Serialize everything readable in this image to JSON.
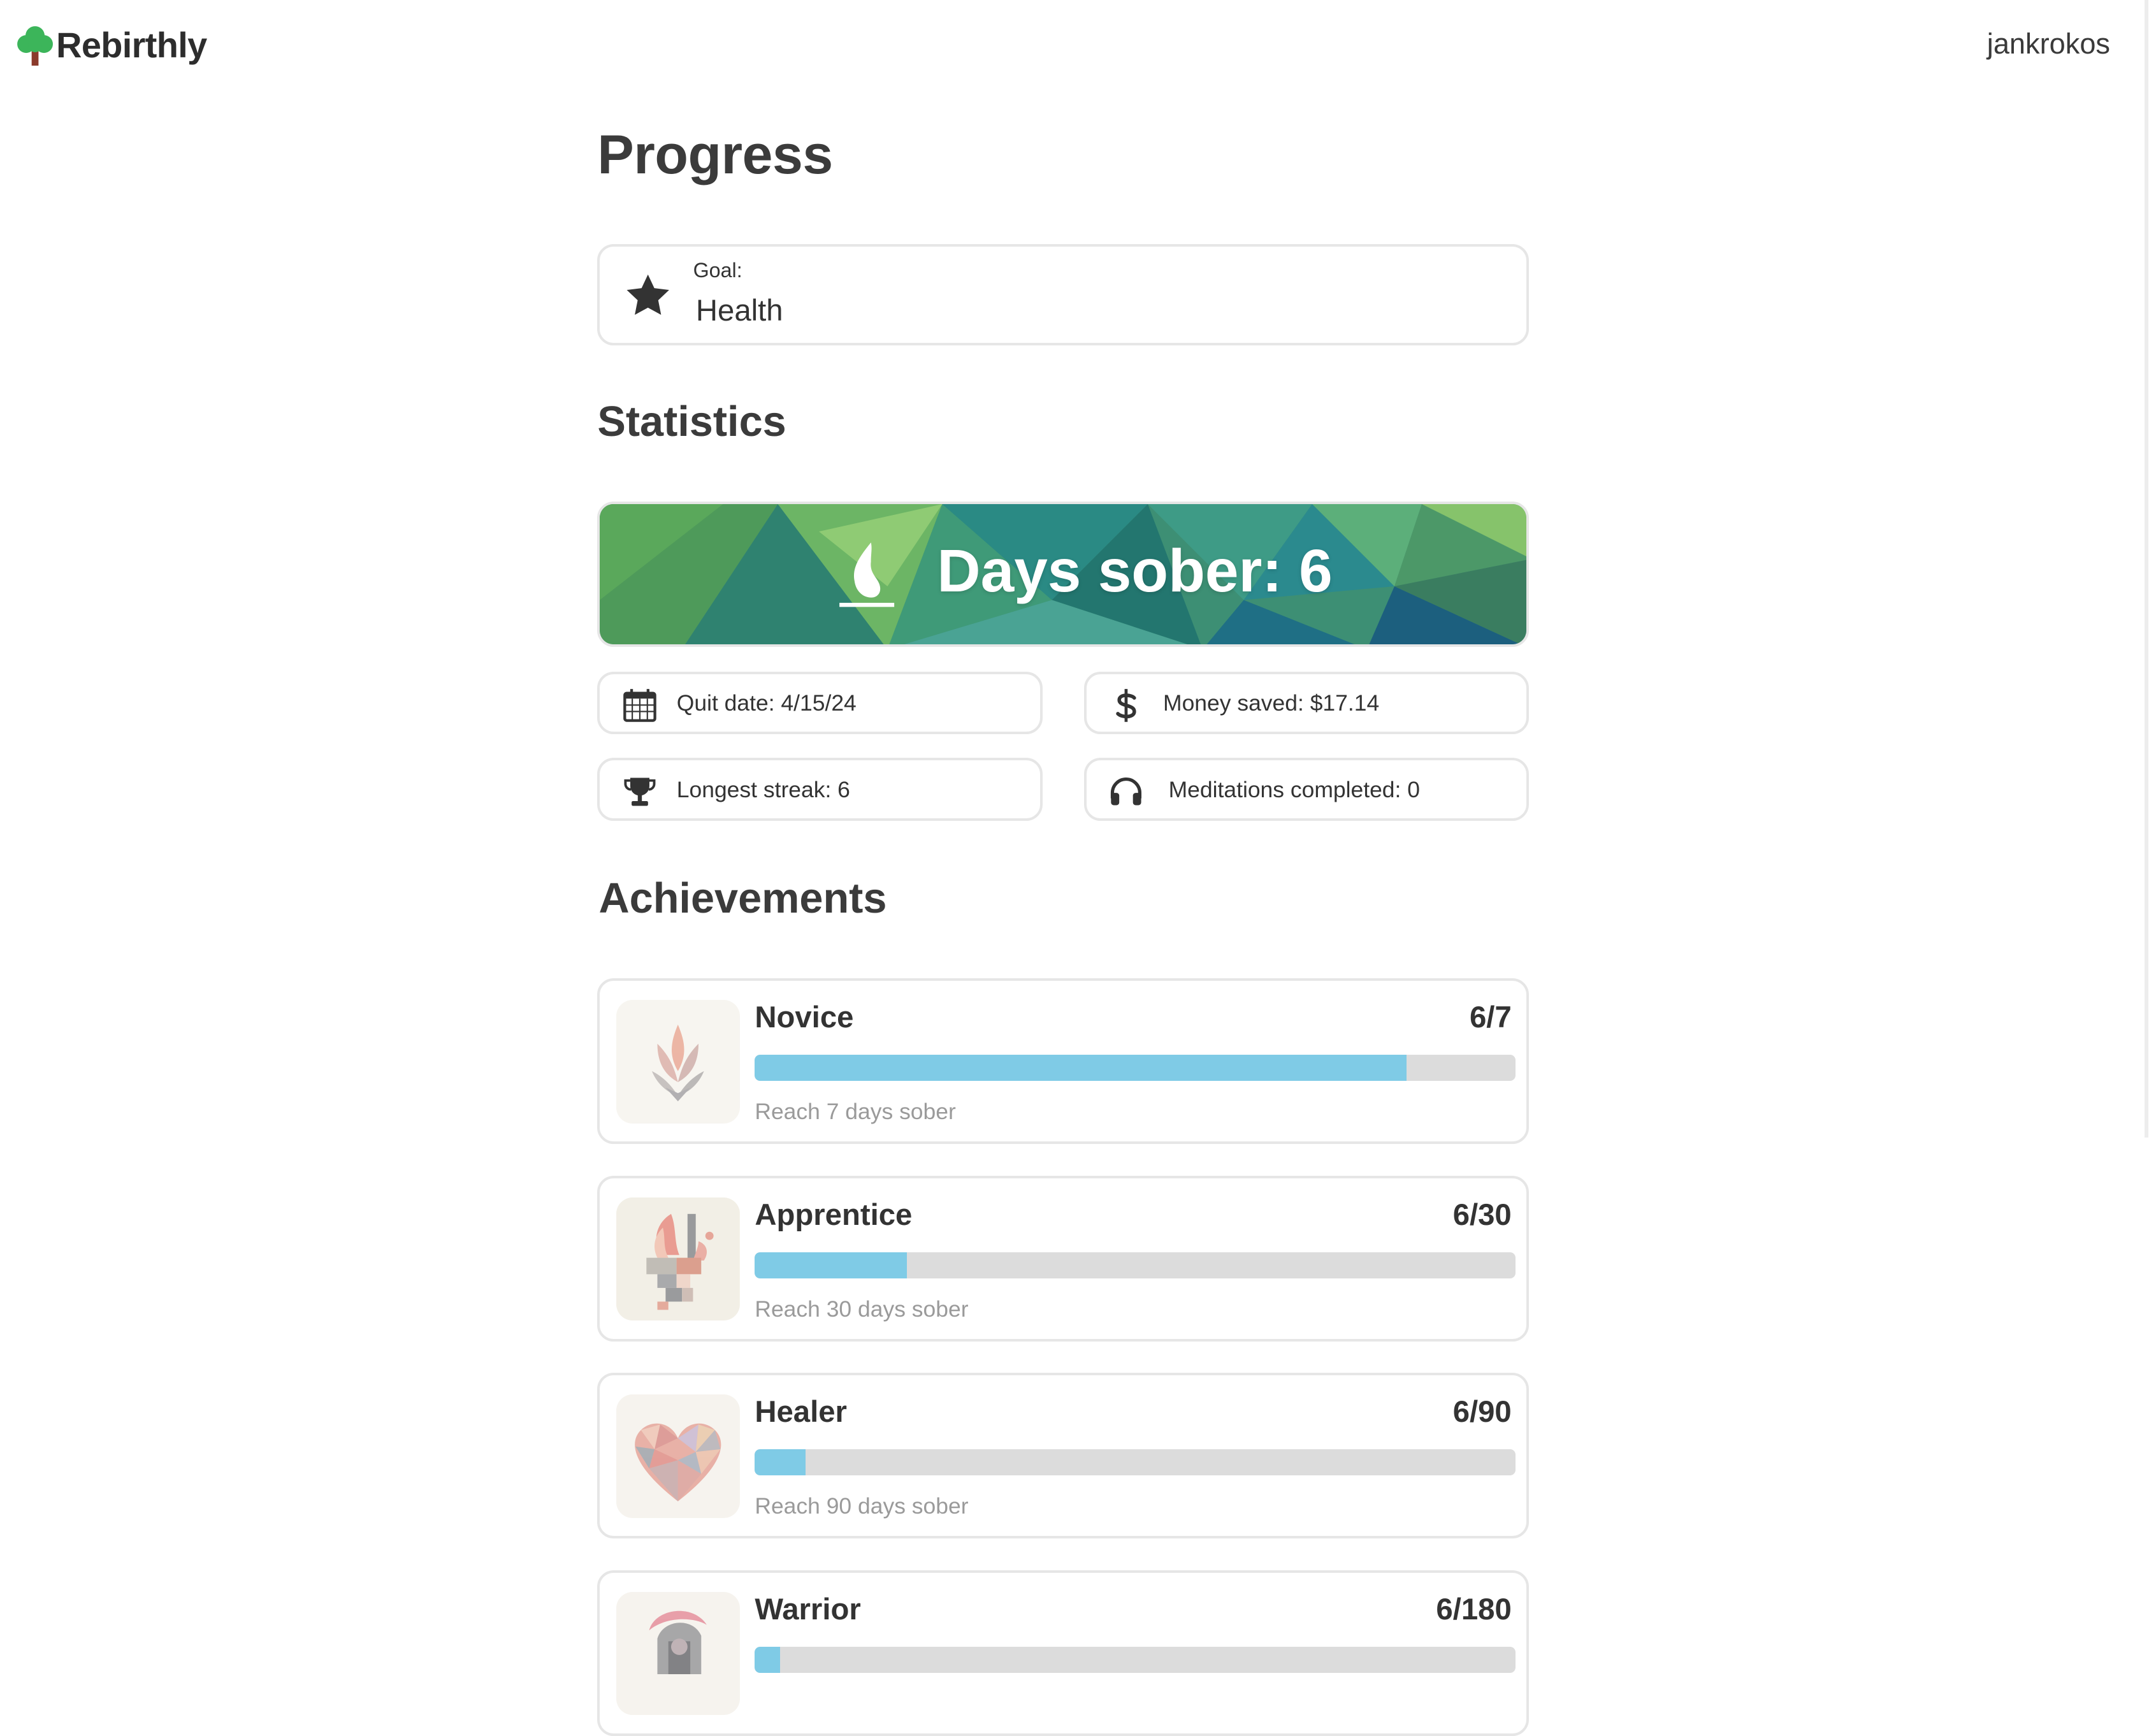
{
  "app": {
    "name": "Rebirthly",
    "username": "jankrokos"
  },
  "page": {
    "title": "Progress"
  },
  "goal": {
    "label": "Goal:",
    "value": "Health"
  },
  "statistics": {
    "title": "Statistics",
    "banner": "Days sober: 6",
    "quit_date": "Quit date: 4/15/24",
    "money_saved": "Money saved: $17.14",
    "longest_streak": "Longest streak: 6",
    "meditations": "Meditations completed: 0"
  },
  "achievements": {
    "title": "Achievements",
    "items": [
      {
        "name": "Novice",
        "progress": "6/7",
        "fraction": 0.857,
        "desc": "Reach 7 days sober"
      },
      {
        "name": "Apprentice",
        "progress": "6/30",
        "fraction": 0.2,
        "desc": "Reach 30 days sober"
      },
      {
        "name": "Healer",
        "progress": "6/90",
        "fraction": 0.0667,
        "desc": "Reach 90 days sober"
      },
      {
        "name": "Warrior",
        "progress": "6/180",
        "fraction": 0.0333,
        "desc": ""
      }
    ]
  },
  "colors": {
    "progress_fill": "#7fcbe6",
    "progress_track": "#dcdcdc",
    "logo_green": "#3cb55a"
  },
  "icons": [
    "tree-logo-icon",
    "star-icon",
    "flame-icon",
    "calendar-icon",
    "dollar-icon",
    "trophy-icon",
    "headphones-icon"
  ]
}
